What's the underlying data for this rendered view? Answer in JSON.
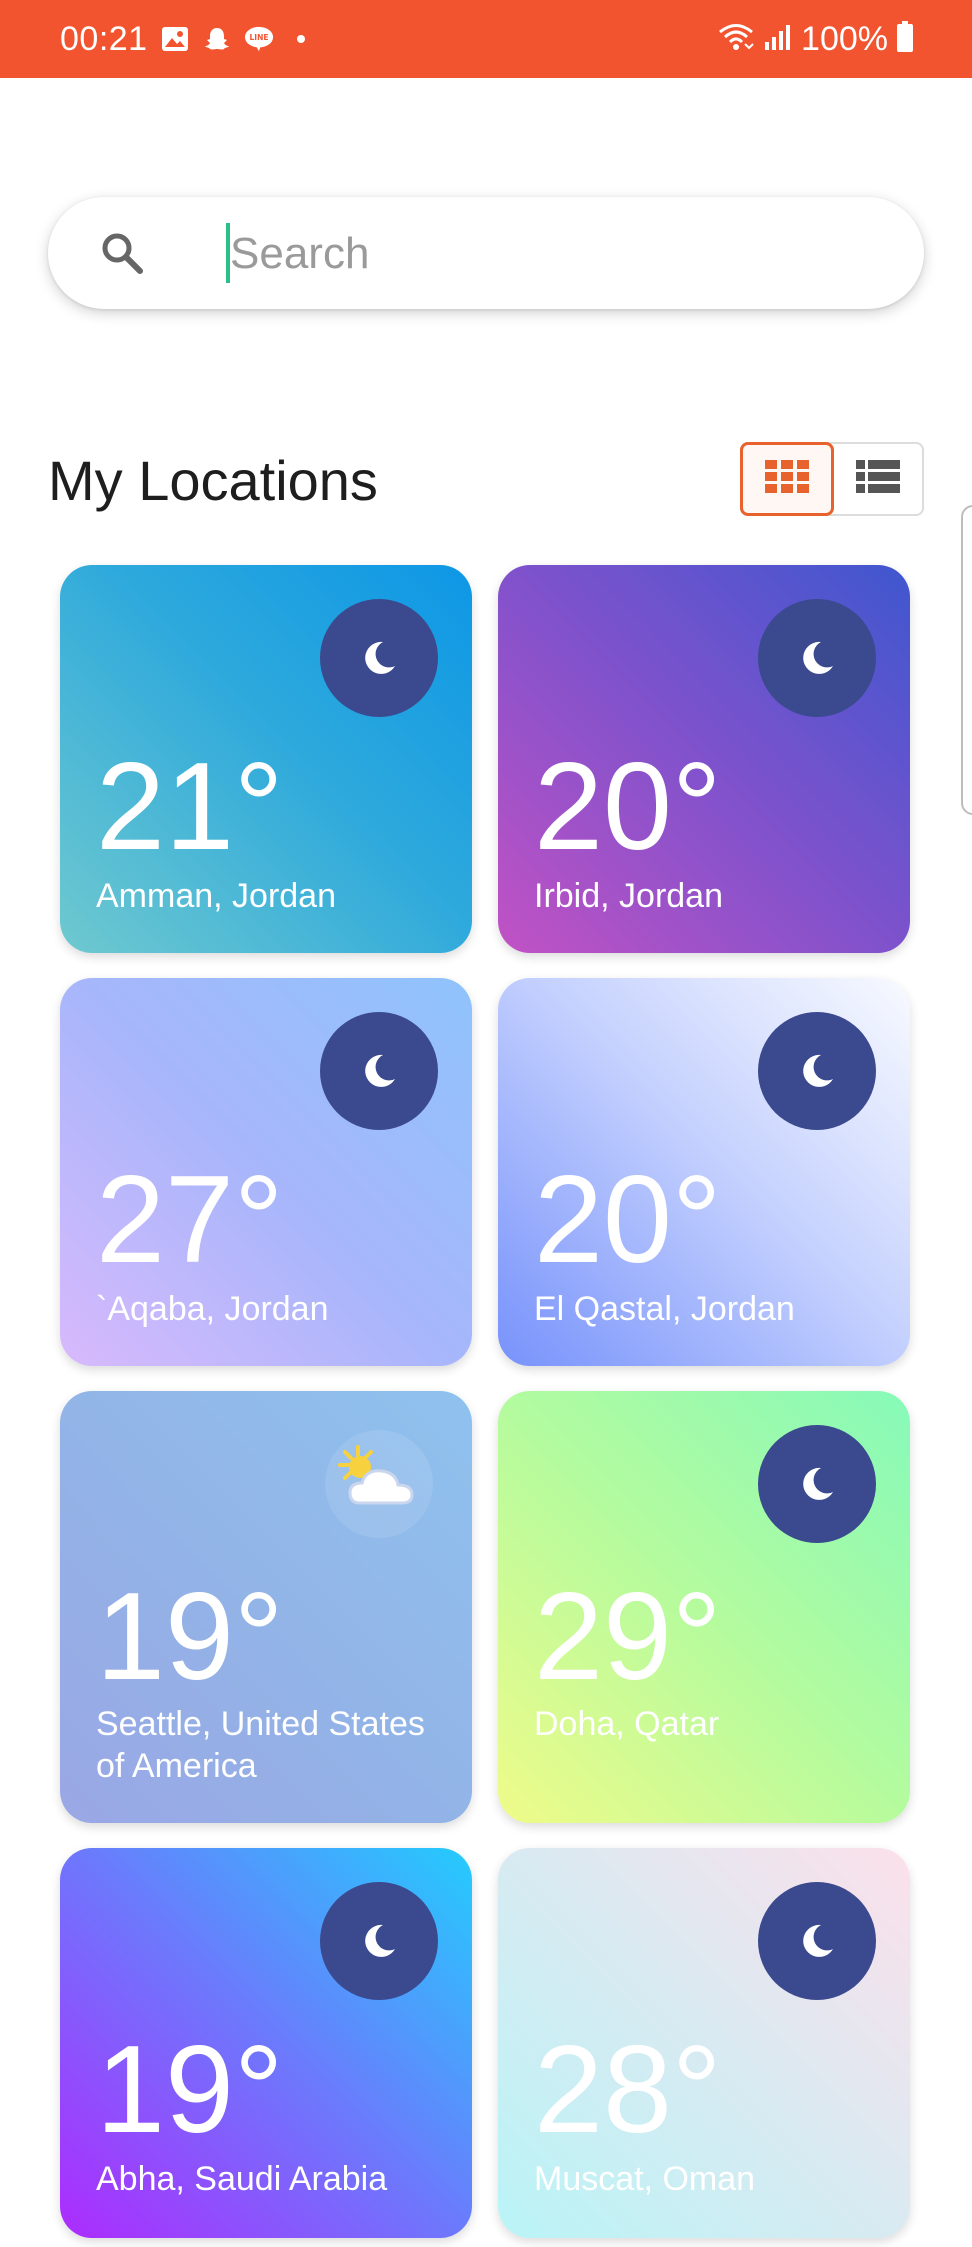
{
  "status_bar": {
    "time": "00:21",
    "battery": "100%",
    "background": "#F35430",
    "left_icons": [
      "gallery-icon",
      "snapchat-icon",
      "line-icon",
      "dot-icon"
    ],
    "right_icons": [
      "wifi-icon",
      "signal-icon",
      "battery-icon"
    ]
  },
  "search": {
    "placeholder": "Search",
    "value": ""
  },
  "section": {
    "title": "My Locations"
  },
  "view_toggle": {
    "selected": "grid",
    "accent": "#E8622E"
  },
  "locations": [
    {
      "temp": "21°",
      "city": "Amman, Jordan",
      "condition": "moon-icon"
    },
    {
      "temp": "20°",
      "city": "Irbid, Jordan",
      "condition": "moon-icon"
    },
    {
      "temp": "27°",
      "city": "`Aqaba, Jordan",
      "condition": "moon-icon"
    },
    {
      "temp": "20°",
      "city": "El Qastal, Jordan",
      "condition": "moon-icon"
    },
    {
      "temp": "19°",
      "city": "Seattle, United States of America",
      "condition": "partly-cloudy-icon"
    },
    {
      "temp": "29°",
      "city": "Doha, Qatar",
      "condition": "moon-icon"
    },
    {
      "temp": "19°",
      "city": "Abha, Saudi Arabia",
      "condition": "moon-icon"
    },
    {
      "temp": "28°",
      "city": "Muscat, Oman",
      "condition": "moon-icon"
    }
  ]
}
